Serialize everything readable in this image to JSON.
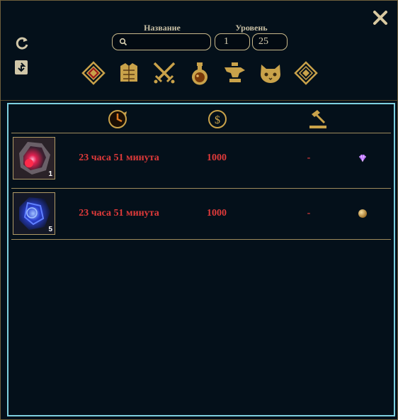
{
  "header": {
    "name_label": "Название",
    "level_label": "Уровень",
    "search_value": "",
    "level_min": "1",
    "level_max": "25"
  },
  "categories": [
    "gem-category-icon",
    "armor-category-icon",
    "weapon-category-icon",
    "potion-category-icon",
    "anvil-category-icon",
    "pet-category-icon",
    "misc-category-icon"
  ],
  "columns": [
    "time-icon",
    "price-icon",
    "bid-icon"
  ],
  "rows": [
    {
      "qty": "1",
      "time": "23 часа 51 минута",
      "price": "1000",
      "bid": "-",
      "currency": "gem"
    },
    {
      "qty": "5",
      "time": "23 часа 51 минута",
      "price": "1000",
      "bid": "-",
      "currency": "gold"
    }
  ],
  "colors": {
    "accent_gold": "#c9a24a",
    "panel_border": "#7ed0e0",
    "text_red": "#e03a3a"
  }
}
